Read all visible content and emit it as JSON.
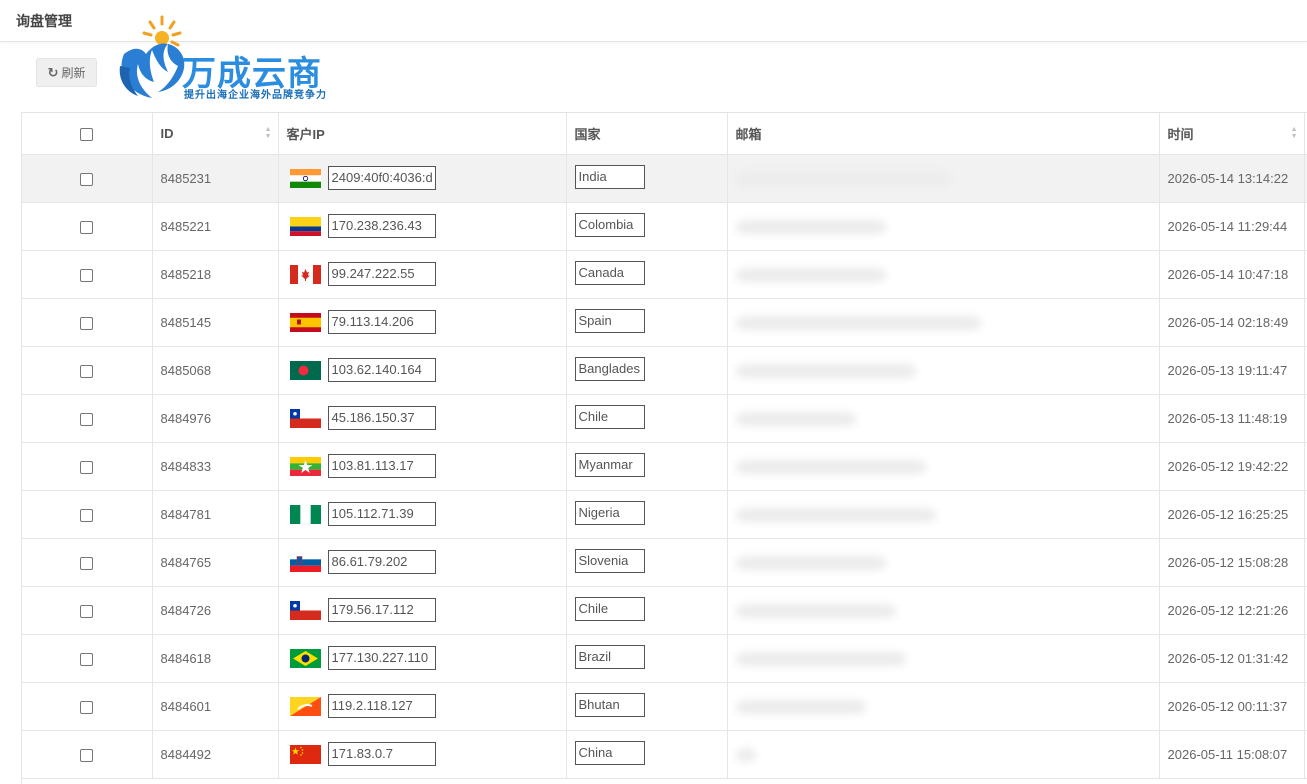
{
  "page": {
    "title": "询盘管理"
  },
  "toolbar": {
    "refresh_label": "刷新"
  },
  "logo": {
    "title": "万成云商",
    "subtitle": "提升出海企业海外品牌竞争力"
  },
  "table": {
    "columns": {
      "id": "ID",
      "ip": "客户IP",
      "country": "国家",
      "email": "邮箱",
      "time": "时间"
    },
    "rows": [
      {
        "id": "8485231",
        "ip": "2409:40f0:4036:d",
        "country": "India",
        "time": "2026-05-14 13:14:22"
      },
      {
        "id": "8485221",
        "ip": "170.238.236.43",
        "country": "Colombia",
        "time": "2026-05-14 11:29:44"
      },
      {
        "id": "8485218",
        "ip": "99.247.222.55",
        "country": "Canada",
        "time": "2026-05-14 10:47:18"
      },
      {
        "id": "8485145",
        "ip": "79.113.14.206",
        "country": "Spain",
        "time": "2026-05-14 02:18:49"
      },
      {
        "id": "8485068",
        "ip": "103.62.140.164",
        "country": "Banglades",
        "time": "2026-05-13 19:11:47"
      },
      {
        "id": "8484976",
        "ip": "45.186.150.37",
        "country": "Chile",
        "time": "2026-05-13 11:48:19"
      },
      {
        "id": "8484833",
        "ip": "103.81.113.17",
        "country": "Myanmar",
        "time": "2026-05-12 19:42:22"
      },
      {
        "id": "8484781",
        "ip": "105.112.71.39",
        "country": "Nigeria",
        "time": "2026-05-12 16:25:25"
      },
      {
        "id": "8484765",
        "ip": "86.61.79.202",
        "country": "Slovenia",
        "time": "2026-05-12 15:08:28"
      },
      {
        "id": "8484726",
        "ip": "179.56.17.112",
        "country": "Chile",
        "time": "2026-05-12 12:21:26"
      },
      {
        "id": "8484618",
        "ip": "177.130.227.110",
        "country": "Brazil",
        "time": "2026-05-12 01:31:42"
      },
      {
        "id": "8484601",
        "ip": "119.2.118.127",
        "country": "Bhutan",
        "time": "2026-05-12 00:11:37"
      },
      {
        "id": "8484492",
        "ip": "171.83.0.7",
        "country": "China",
        "time": "2026-05-11 15:08:07"
      }
    ]
  }
}
